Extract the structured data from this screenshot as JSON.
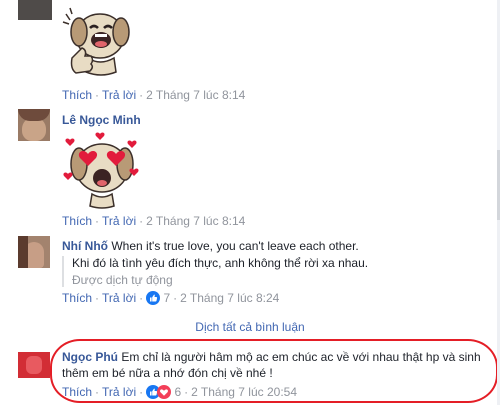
{
  "comments": [
    {
      "actions": {
        "like": "Thích",
        "reply": "Trả lời",
        "time": "2 Tháng 7 lúc 8:14"
      }
    },
    {
      "author": "Lê Ngọc Minh",
      "actions": {
        "like": "Thích",
        "reply": "Trả lời",
        "time": "2 Tháng 7 lúc 8:14"
      }
    },
    {
      "author": "Nhí Nhố",
      "text": "When it's true love, you can't leave each other.",
      "translation": "Khi đó là tình yêu đích thực, anh không thể rời xa nhau.",
      "translated_by": "Được dịch tự động",
      "actions": {
        "like": "Thích",
        "reply": "Trả lời",
        "reaction_count": "7",
        "time": "2 Tháng 7 lúc 8:24"
      }
    },
    {
      "author": "Ngọc Phú",
      "text_line1": "Em chỉ là người hâm mộ ac em chúc ac về với nhau thật hp và sinh",
      "text_line2": "thêm em bé nữa a nhớ đón chị về nhé !",
      "actions": {
        "like": "Thích",
        "reply": "Trả lời",
        "reaction_count": "6",
        "time": "2 Tháng 7 lúc 20:54"
      }
    }
  ],
  "translate_all": "Dịch tất cả bình luận",
  "colors": {
    "link": "#4267b2",
    "name": "#385898",
    "muted": "#90949c",
    "highlight": "#e41e26",
    "like_blue": "#1877f2",
    "love_red": "#f33e58"
  },
  "icons": {
    "thumbs_up_sticker": "dog-thumbs-up-sticker",
    "heart_eyes_sticker": "dog-heart-eyes-sticker",
    "like_reaction": "like-reaction-icon",
    "love_reaction": "love-reaction-icon"
  }
}
